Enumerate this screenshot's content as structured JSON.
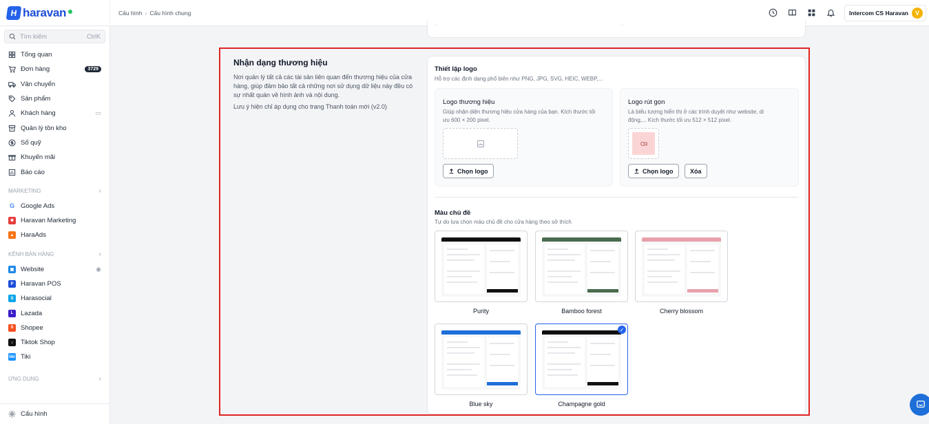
{
  "header": {
    "logo_text": "haravan",
    "breadcrumb": [
      "Cấu hình",
      "Cấu hình chung"
    ],
    "account_name": "Intercom CS Haravan",
    "account_initial": "V"
  },
  "sidebar": {
    "search_placeholder": "Tìm kiếm",
    "search_shortcut": "CtrlK",
    "items": [
      {
        "label": "Tổng quan",
        "icon": "dashboard-icon"
      },
      {
        "label": "Đơn hàng",
        "icon": "cart-icon",
        "badge": "3729"
      },
      {
        "label": "Vận chuyển",
        "icon": "truck-icon"
      },
      {
        "label": "Sản phẩm",
        "icon": "tag-icon"
      },
      {
        "label": "Khách hàng",
        "icon": "user-icon"
      },
      {
        "label": "Quản lý tồn kho",
        "icon": "inventory-icon"
      },
      {
        "label": "Sổ quỹ",
        "icon": "cash-icon"
      },
      {
        "label": "Khuyến mãi",
        "icon": "promotion-icon"
      },
      {
        "label": "Báo cáo",
        "icon": "report-icon"
      }
    ],
    "marketing_section": "MARKETING",
    "marketing_items": [
      "Google Ads",
      "Haravan Marketing",
      "HaraAds"
    ],
    "channels_section": "KÊNH BÁN HÀNG",
    "channel_items": [
      "Website",
      "Haravan POS",
      "Harasocial",
      "Lazada",
      "Shopee",
      "Tiktok Shop",
      "Tiki"
    ],
    "apps_section": "ỨNG DỤNG",
    "settings_label": "Cấu hình"
  },
  "brand_section": {
    "title": "Nhận dạng thương hiệu",
    "description": "Nơi quản lý tất cả các tài sản liên quan đến thương hiệu của cửa hàng, giúp đảm bảo tất cả những nơi sử dụng dữ liệu này đều có sự nhất quán về hình ảnh và nội dung.",
    "note": "Lưu ý hiện chỉ áp dụng cho trang Thanh toán mới (v2.0)"
  },
  "logo_setup": {
    "title": "Thiết lập logo",
    "subtitle": "Hỗ trợ các định dạng phổ biến như PNG, JPG, SVG, HEIC, WEBP,...",
    "brand_logo": {
      "title": "Logo thương hiệu",
      "desc_line1": "Giúp nhận diện thương hiệu cửa hàng của bạn. Kích thước tối",
      "desc_line2": "ưu 600 × 200 pixel.",
      "button": "Chọn logo"
    },
    "short_logo": {
      "title": "Logo rút gọn",
      "desc_line1": "Là biểu tượng hiển thị ở các trình duyệt như website, di",
      "desc_line2": "động,... Kích thước tối ưu 512 × 512 pixel.",
      "button": "Chọn logo",
      "delete_button": "Xóa"
    }
  },
  "theme_section": {
    "title": "Màu chủ đề",
    "subtitle": "Tự do lựa chọn màu chủ đề cho cửa hàng theo sở thích",
    "themes": [
      {
        "name": "Purity",
        "accent": "#111111",
        "selected": false
      },
      {
        "name": "Bamboo forest",
        "accent": "#4a6b4f",
        "selected": false
      },
      {
        "name": "Cherry blossom",
        "accent": "#e8a1ab",
        "selected": false
      },
      {
        "name": "Blue sky",
        "accent": "#1e6fd9",
        "selected": false
      },
      {
        "name": "Champagne gold",
        "accent": "#111111",
        "selected": true
      }
    ]
  },
  "colors": {
    "brand": "#1d4ed8",
    "highlight_border": "#e02424",
    "selected": "#2563eb"
  }
}
